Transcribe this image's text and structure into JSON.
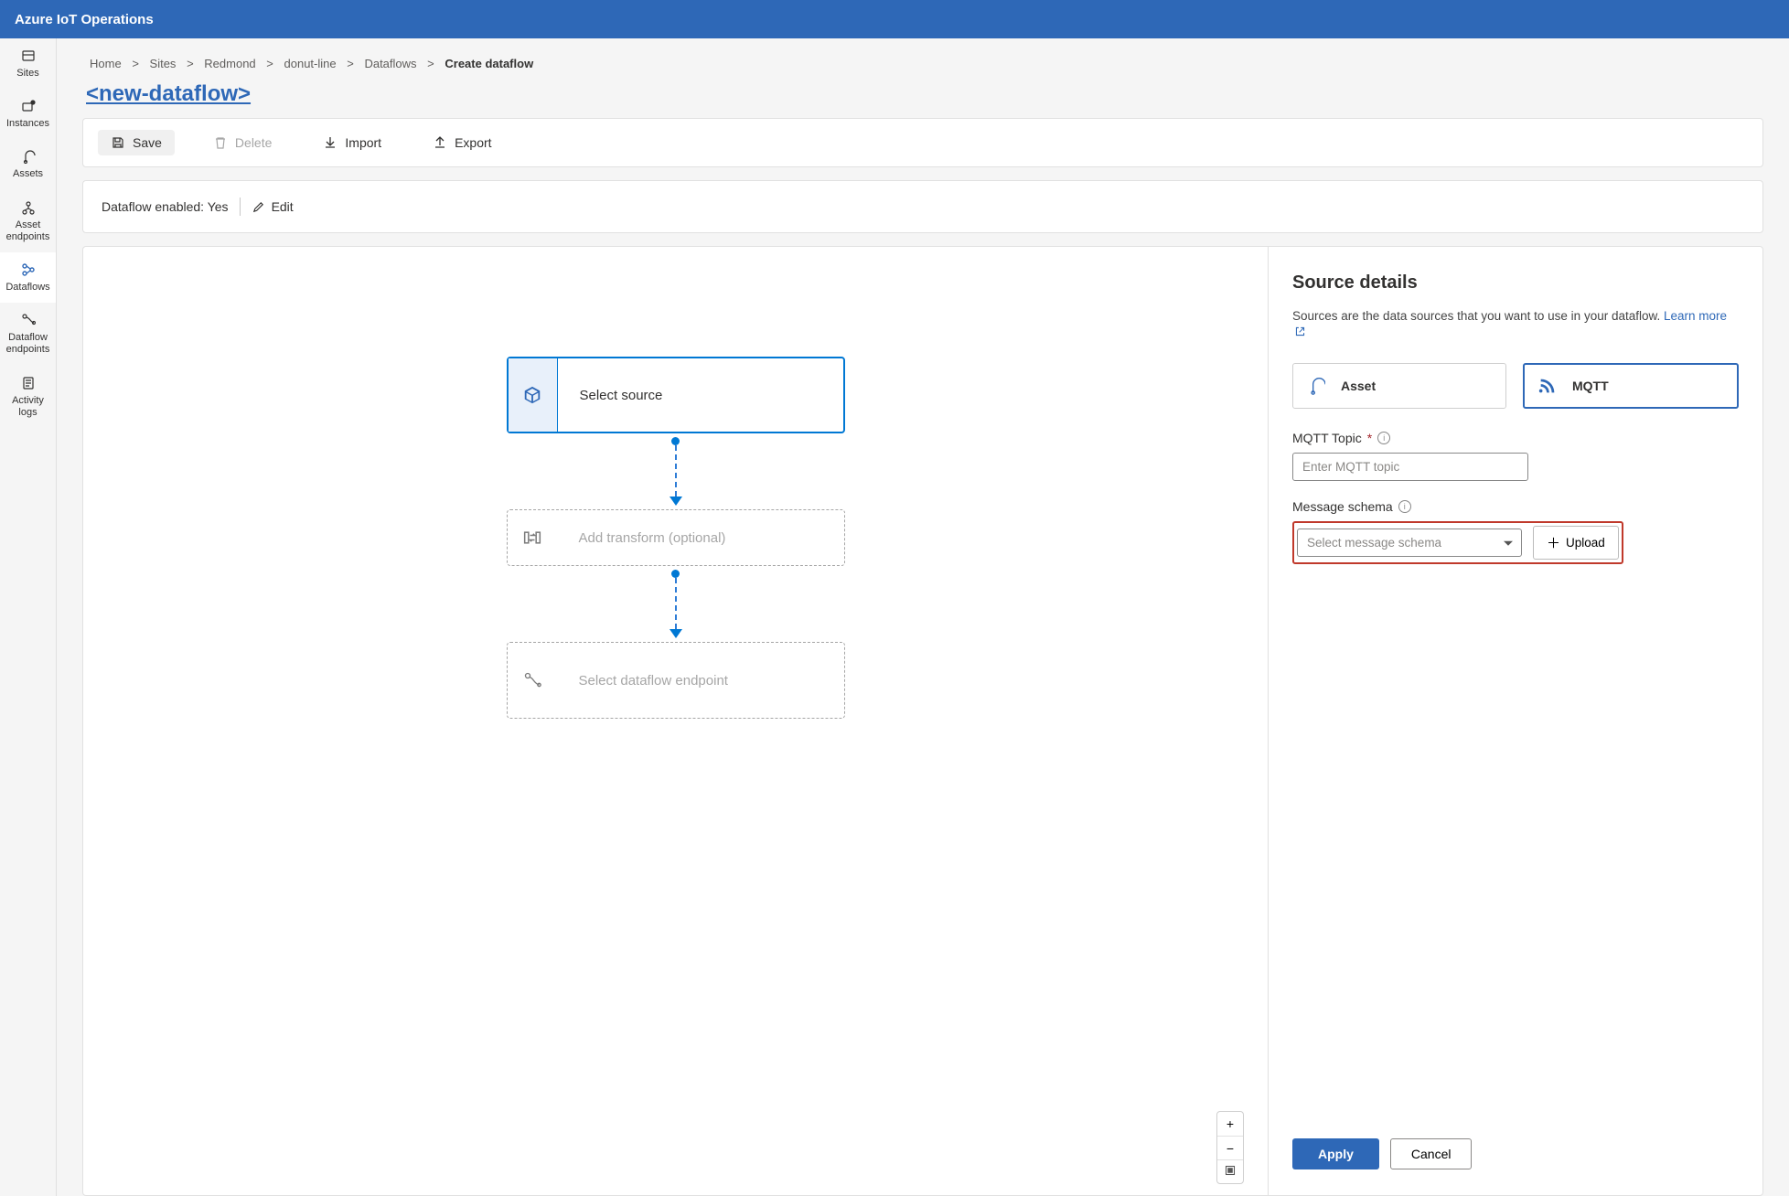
{
  "app": {
    "title": "Azure IoT Operations"
  },
  "sidebar": {
    "items": [
      {
        "label": "Sites"
      },
      {
        "label": "Instances"
      },
      {
        "label": "Assets"
      },
      {
        "label": "Asset endpoints"
      },
      {
        "label": "Dataflows"
      },
      {
        "label": "Dataflow endpoints"
      },
      {
        "label": "Activity logs"
      }
    ]
  },
  "breadcrumb": {
    "items": [
      "Home",
      "Sites",
      "Redmond",
      "donut-line",
      "Dataflows"
    ],
    "current": "Create dataflow",
    "separator": ">"
  },
  "page": {
    "title": "<new-dataflow>"
  },
  "toolbar": {
    "save": "Save",
    "delete": "Delete",
    "import": "Import",
    "export": "Export"
  },
  "status": {
    "enabled_label": "Dataflow enabled: Yes",
    "edit": "Edit"
  },
  "canvas": {
    "source": "Select source",
    "transform": "Add transform (optional)",
    "destination": "Select dataflow endpoint",
    "zoom": {
      "in": "+",
      "out": "−",
      "fit": "▣"
    }
  },
  "details": {
    "title": "Source details",
    "description": "Sources are the data sources that you want to use in your dataflow. ",
    "learn_more": "Learn more",
    "choices": {
      "asset": "Asset",
      "mqtt": "MQTT"
    },
    "topic": {
      "label": "MQTT Topic",
      "placeholder": "Enter MQTT topic"
    },
    "schema": {
      "label": "Message schema",
      "placeholder": "Select message schema",
      "upload": "Upload"
    },
    "apply": "Apply",
    "cancel": "Cancel"
  }
}
